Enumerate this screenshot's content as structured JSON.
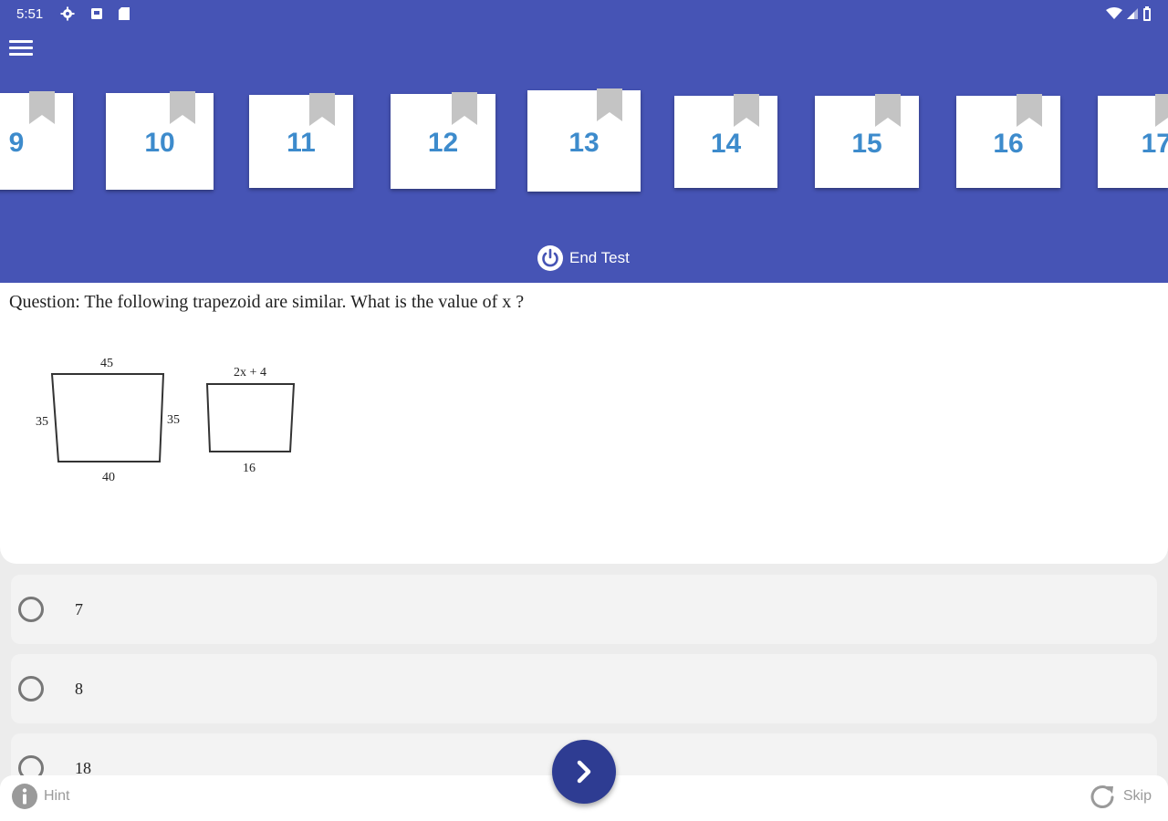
{
  "status_bar": {
    "time": "5:51",
    "icons": [
      "settings-icon",
      "notification-icon",
      "sd-card-icon"
    ],
    "right_icons": [
      "wifi-icon",
      "signal-icon",
      "battery-icon"
    ]
  },
  "header": {
    "menu_icon": "menu-icon",
    "question_numbers": [
      "9",
      "10",
      "11",
      "12",
      "13",
      "14",
      "15",
      "16",
      "17"
    ],
    "current_question": "13",
    "end_test_label": "End Test",
    "colors": {
      "header_bg": "#4654b5",
      "number_color": "#3d8bcc"
    }
  },
  "question": {
    "text": "Question: The following trapezoid are similar. What is the value of x ?",
    "figure": {
      "trapezoid1": {
        "top": "45",
        "left": "35",
        "right": "35",
        "bottom": "40"
      },
      "trapezoid2": {
        "top": "2x + 4",
        "bottom": "16"
      }
    }
  },
  "options": [
    {
      "label": "7"
    },
    {
      "label": "8"
    },
    {
      "label": "18"
    }
  ],
  "bottom_bar": {
    "hint_label": "Hint",
    "skip_label": "Skip",
    "next_icon": "chevron-right-icon"
  }
}
